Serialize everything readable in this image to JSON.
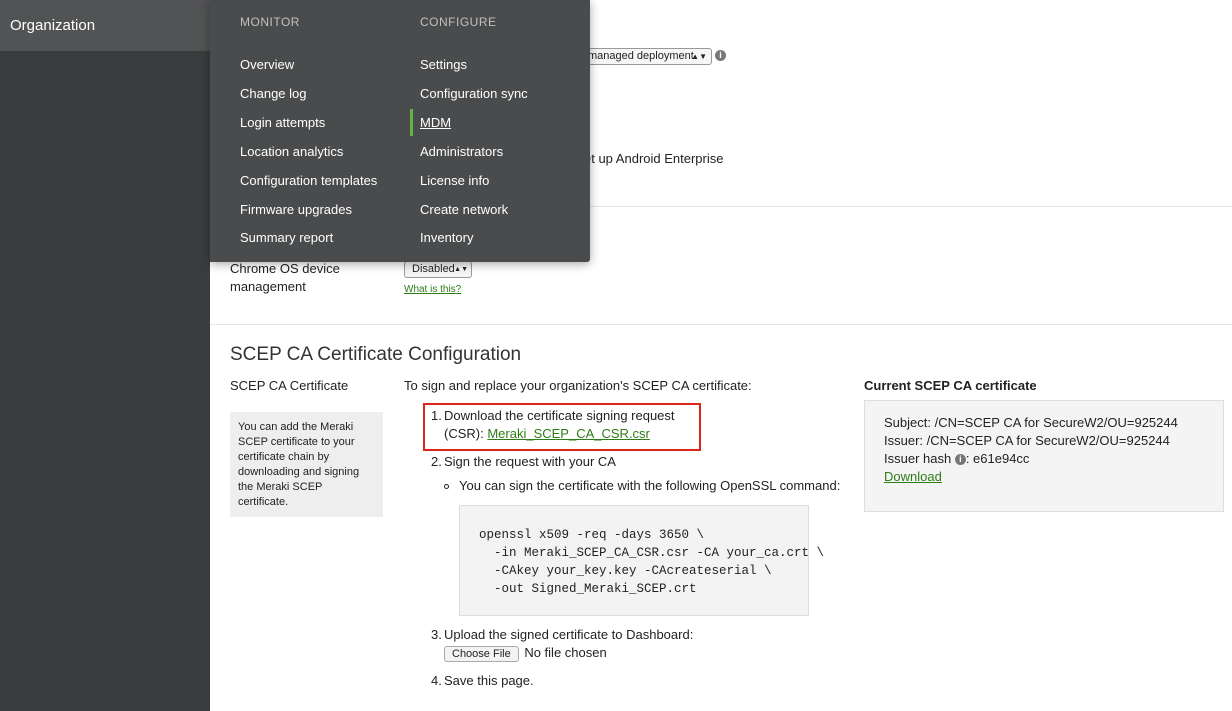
{
  "sidebar": {
    "org_label": "Organization"
  },
  "menu": {
    "monitor": {
      "heading": "MONITOR",
      "items": [
        "Overview",
        "Change log",
        "Login attempts",
        "Location analytics",
        "Configuration templates",
        "Firmware upgrades",
        "Summary report"
      ]
    },
    "configure": {
      "heading": "CONFIGURE",
      "items": [
        "Settings",
        "Configuration sync",
        "MDM",
        "Administrators",
        "License info",
        "Create network",
        "Inventory"
      ],
      "active": "MDM"
    }
  },
  "partial": {
    "deployment_select": "managed deployment",
    "android_link": "et up Android Enterprise"
  },
  "chrome": {
    "label": "Chrome OS device management",
    "select_value": "Disabled",
    "whatis": "What is this?"
  },
  "scep": {
    "title": "SCEP CA Certificate Configuration",
    "label": "SCEP CA Certificate",
    "hint": "You can add the Meraki SCEP certificate to your certificate chain by downloading and signing the Meraki SCEP certificate.",
    "intro": "To sign and replace your organization's SCEP CA certificate:",
    "step1_num": "1.",
    "step1_text": "Download the certificate signing request",
    "step1_text2": "(CSR):",
    "step1_link": "Meraki_SCEP_CA_CSR.csr",
    "step2_num": "2.",
    "step2_text": "Sign the request with your CA",
    "step2_sub": "You can sign the certificate with the following OpenSSL command:",
    "code": "openssl x509 -req -days 3650 \\\n  -in Meraki_SCEP_CA_CSR.csr -CA your_ca.crt \\\n  -CAkey your_key.key -CAcreateserial \\\n  -out Signed_Meraki_SCEP.crt",
    "step3_num": "3.",
    "step3_text": "Upload the signed certificate to Dashboard:",
    "choose_file": "Choose File",
    "no_file": "No file chosen",
    "step4_num": "4.",
    "step4_text": "Save this page.",
    "current_heading": "Current SCEP CA certificate",
    "subject": "Subject: /CN=SCEP CA for SecureW2/OU=925244",
    "issuer": "Issuer: /CN=SCEP CA for SecureW2/OU=925244",
    "issuer_hash_label": "Issuer hash",
    "issuer_hash_value": ": e61e94cc",
    "download": "Download"
  },
  "colors": {
    "sidebar": "#3b3c3d",
    "menu": "#4a4b4c",
    "accent_green": "#65b14a",
    "link_green": "#2d7d17",
    "highlight_red": "#d9281b"
  }
}
